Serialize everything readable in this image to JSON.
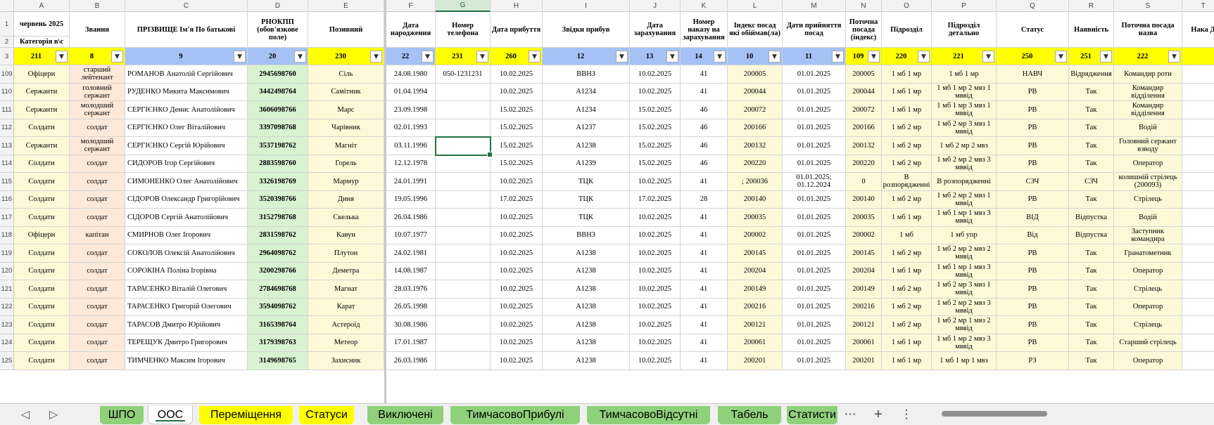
{
  "columns": [
    {
      "letter": "A",
      "width": 79
    },
    {
      "letter": "B",
      "width": 79
    },
    {
      "letter": "C",
      "width": 174
    },
    {
      "letter": "D",
      "width": 86
    },
    {
      "letter": "E",
      "width": 108
    },
    {
      "letter": "F",
      "width": 70
    },
    {
      "letter": "G",
      "width": 78
    },
    {
      "letter": "H",
      "width": 74
    },
    {
      "letter": "I",
      "width": 124
    },
    {
      "letter": "J",
      "width": 72
    },
    {
      "letter": "K",
      "width": 67
    },
    {
      "letter": "L",
      "width": 78
    },
    {
      "letter": "M",
      "width": 90
    },
    {
      "letter": "N",
      "width": 51
    },
    {
      "letter": "O",
      "width": 71
    },
    {
      "letter": "P",
      "width": 92
    },
    {
      "letter": "Q",
      "width": 103
    },
    {
      "letter": "R",
      "width": 64
    },
    {
      "letter": "S",
      "width": 97
    },
    {
      "letter": "T",
      "width": 60
    }
  ],
  "header_row1_2": [
    "",
    "Звання",
    "ПРІЗВИЩЕ Ім'я По батькові",
    "РНОКПП (обов'язкове поле)",
    "Позивний",
    "Дата народження",
    "Номер телефона",
    "Дата прибуття",
    "Звідки прибув",
    "Дата зарахування",
    "Номер наказу на зарахування",
    "Індекс посад які обіймав(ла)",
    "Дати прийняття посад",
    "Поточна посада (індекс)",
    "Підрозділ",
    "Підрозділ детально",
    "Статус",
    "Наявність",
    "Поточна посада назва",
    "Нака Д"
  ],
  "header_a_top": "червень 2025",
  "header_a_bottom": "Категорія в\\с",
  "row3_values": [
    "211",
    "8",
    "9",
    "20",
    "230",
    "22",
    "231",
    "260",
    "12",
    "13",
    "14",
    "10",
    "11",
    "109",
    "220",
    "221",
    "250",
    "251",
    "222",
    ""
  ],
  "row3_colors": [
    "#ffff00",
    "#ffff00",
    "#a4c2f4",
    "#a4c2f4",
    "#ffff00",
    "#a4c2f4",
    "#ffff00",
    "#ffff00",
    "#a4c2f4",
    "#a4c2f4",
    "#a4c2f4",
    "#a4c2f4",
    "#a4c2f4",
    "#ffff00",
    "#ffff00",
    "#ffff00",
    "#ffff00",
    "#ffff00",
    "#ffff00",
    "#ffff00"
  ],
  "col_fills": [
    "#fdf8d7",
    "#fde9d9",
    "#ffffff",
    "#d9f2d0",
    "#fdf8d7",
    "#ffffff",
    "#ffffff",
    "#ffffff",
    "#ffffff",
    "#ffffff",
    "#ffffff",
    "#fdf8d7",
    "#ffffff",
    "#fdf8d7",
    "#fdf8d7",
    "#fdf8d7",
    "#fdf8d7",
    "#fdf8d7",
    "#fdf8d7",
    "#ffffff"
  ],
  "rows": [
    {
      "n": "109",
      "cells": [
        "Офіцери",
        "старший лейтенант",
        "РОМАНОВ Анатолій Сергійович",
        "2945698760",
        "Сіль",
        "24.08.1980",
        "050-1231231",
        "10.02.2025",
        "ВВНЗ",
        "10.02.2025",
        "41",
        "200005",
        "01.01.2025",
        "200005",
        "1 мб 1 мр",
        "1 мб 1 мр",
        "НАВЧ",
        "Відрядження",
        "Командир роти",
        ""
      ]
    },
    {
      "n": "110",
      "cells": [
        "Сержанти",
        "головний сержант",
        "РУДЕНКО Микита Максимович",
        "3442498764",
        "Самітник",
        "01.04.1994",
        "",
        "10.02.2025",
        "А1234",
        "10.02.2025",
        "41",
        "200044",
        "01.01.2025",
        "200044",
        "1 мб 1 мр",
        "1 мб 1 мр 2 мвз 1 мввід",
        "РВ",
        "Так",
        "Командир відділення",
        ""
      ]
    },
    {
      "n": "111",
      "cells": [
        "Сержанти",
        "молодший сержант",
        "СЕРГІЄНКО Денис Анатолійович",
        "3606098766",
        "Марс",
        "23.09.1998",
        "",
        "15.02.2025",
        "А1234",
        "15.02.2025",
        "46",
        "200072",
        "01.01.2025",
        "200072",
        "1 мб 1 мр",
        "1 мб 1 мр 3 мвз 1 мввід",
        "РВ",
        "Так",
        "Командир відділення",
        ""
      ]
    },
    {
      "n": "112",
      "cells": [
        "Солдати",
        "солдат",
        "СЕРГІЄНКО Олег Віталійович",
        "3397098768",
        "Чарівник",
        "02.01.1993",
        "",
        "15.02.2025",
        "А1237",
        "15.02.2025",
        "46",
        "200166",
        "01.01.2025",
        "200166",
        "1 мб 2 мр",
        "1 мб 2 мр 3 мвз 1 мввід",
        "РВ",
        "Так",
        "Водій",
        ""
      ]
    },
    {
      "n": "113",
      "cells": [
        "Сержанти",
        "молодший сержант",
        "СЕРГІЄНКО Сергій Юрійович",
        "3537198762",
        "Магніт",
        "03.11.1996",
        "",
        "15.02.2025",
        "А1238",
        "15.02.2025",
        "46",
        "200132",
        "01.01.2025",
        "200132",
        "1 мб 2 мр",
        "1 мб 2 мр 2 мвз",
        "РВ",
        "Так",
        "Головний сержант взводу",
        ""
      ]
    },
    {
      "n": "114",
      "cells": [
        "Солдати",
        "солдат",
        "СИДОРОВ Ігор Сергійович",
        "2883598760",
        "Горель",
        "12.12.1978",
        "",
        "15.02.2025",
        "А1239",
        "15.02.2025",
        "46",
        "200220",
        "01.01.2025",
        "200220",
        "1 мб 2 мр",
        "1 мб 2 мр 2 мвз 3 мввід",
        "РВ",
        "Так",
        "Оператор",
        ""
      ]
    },
    {
      "n": "115",
      "cells": [
        "Солдати",
        "солдат",
        "СИМОНЕНКО Олег Анатолійович",
        "3326198769",
        "Мармур",
        "24.01.1991",
        "",
        "10.02.2025",
        "ТЦК",
        "10.02.2025",
        "41",
        "; 200036",
        "01.01.2025; 01.12.2024",
        "0",
        "В розпорядженні",
        "В розпорядженні",
        "СЗЧ",
        "СЗЧ",
        "колишній стрілець (200093)",
        ""
      ]
    },
    {
      "n": "116",
      "cells": [
        "Солдати",
        "солдат",
        "СІДОРОВ Олександр Григорійович",
        "3520398766",
        "Диня",
        "19.05.1996",
        "",
        "17.02.2025",
        "ТЦК",
        "17.02.2025",
        "28",
        "200140",
        "01.01.2025",
        "200140",
        "1 мб 2 мр",
        "1 мб 2 мр 2 мвз 1 мввід",
        "РВ",
        "Так",
        "Стрілець",
        ""
      ]
    },
    {
      "n": "117",
      "cells": [
        "Солдати",
        "солдат",
        "СІДОРОВ Сергій Анатолійович",
        "3152798768",
        "Скелька",
        "26.04.1986",
        "",
        "10.02.2025",
        "ТЦК",
        "10.02.2025",
        "41",
        "200035",
        "01.01.2025",
        "200035",
        "1 мб 1 мр",
        "1 мб 1 мр 1 мвз 3 мввід",
        "ВІД",
        "Відпустка",
        "Водій",
        ""
      ]
    },
    {
      "n": "118",
      "cells": [
        "Офіцери",
        "капітан",
        "СМИРНОВ Олег Ігорович",
        "2831598762",
        "Кавун",
        "10.07.1977",
        "",
        "10.02.2025",
        "ВВНЗ",
        "10.02.2025",
        "41",
        "200002",
        "01.01.2025",
        "200002",
        "1 мб",
        "1 мб упр",
        "Від",
        "Відпустка",
        "Заступник командира",
        ""
      ]
    },
    {
      "n": "119",
      "cells": [
        "Солдати",
        "солдат",
        "СОКОЛОВ Олексій Анатолійович",
        "2964098762",
        "Плутон",
        "24.02.1981",
        "",
        "10.02.2025",
        "А1238",
        "10.02.2025",
        "41",
        "200145",
        "01.01.2025",
        "200145",
        "1 мб 2 мр",
        "1 мб 2 мр 2 мвз 2 мввід",
        "РВ",
        "Так",
        "Гранатометник",
        ""
      ]
    },
    {
      "n": "120",
      "cells": [
        "Солдати",
        "солдат",
        "СОРОКІНА Поліна Ігорівна",
        "3200298766",
        "Деметра",
        "14.08.1987",
        "",
        "10.02.2025",
        "А1238",
        "10.02.2025",
        "41",
        "200204",
        "01.01.2025",
        "200204",
        "1 мб 1 мр",
        "1 мб 1 мр 1 мвз 3 мввід",
        "РВ",
        "Так",
        "Оператор",
        ""
      ]
    },
    {
      "n": "121",
      "cells": [
        "Солдати",
        "солдат",
        "ТАРАСЕНКО Віталій Олегович",
        "2784698768",
        "Магнат",
        "28.03.1976",
        "",
        "10.02.2025",
        "А1238",
        "10.02.2025",
        "41",
        "200149",
        "01.01.2025",
        "200149",
        "1 мб 2 мр",
        "1 мб 2 мр 3 мвз 1 мввід",
        "РВ",
        "Так",
        "Стрілець",
        ""
      ]
    },
    {
      "n": "122",
      "cells": [
        "Солдати",
        "солдат",
        "ТАРАСЕНКО Григорій Олегович",
        "3594098762",
        "Карат",
        "26.05.1998",
        "",
        "10.02.2025",
        "А1238",
        "10.02.2025",
        "41",
        "200216",
        "01.01.2025",
        "200216",
        "1 мб 2 мр",
        "1 мб 2 мр 2 мвз 3 мввід",
        "РВ",
        "Так",
        "Оператор",
        ""
      ]
    },
    {
      "n": "123",
      "cells": [
        "Солдати",
        "солдат",
        "ТАРАСОВ Дмитро Юрійович",
        "3165398764",
        "Астероїд",
        "30.08.1986",
        "",
        "10.02.2025",
        "А1238",
        "10.02.2025",
        "41",
        "200121",
        "01.01.2025",
        "200121",
        "1 мб 2 мр",
        "1 мб 2 мр 1 мвз 2 мввід",
        "РВ",
        "Так",
        "Стрілець",
        ""
      ]
    },
    {
      "n": "124",
      "cells": [
        "Солдати",
        "солдат",
        "ТЕРЕЩУК Дмитро Григорович",
        "3179398763",
        "Метеор",
        "17.01.1987",
        "",
        "10.02.2025",
        "А1238",
        "10.02.2025",
        "41",
        "200061",
        "01.01.2025",
        "200061",
        "1 мб 1 мр",
        "1 мб 1 мр 2 мвз 3 мввід",
        "РВ",
        "Так",
        "Старший стрілець",
        ""
      ]
    },
    {
      "n": "125",
      "cells": [
        "Солдати",
        "солдат",
        "ТИМЧЕНКО Максим Ігорович",
        "3149698765",
        "Захисник",
        "26.03.1986",
        "",
        "10.02.2025",
        "А1238",
        "10.02.2025",
        "41",
        "200201",
        "01.01.2025",
        "200201",
        "1 мб 1 мр",
        "1 мб 1 мр 1 мвз",
        "РЗ",
        "Так",
        "Оператор",
        ""
      ]
    }
  ],
  "tabs": [
    {
      "label": "ШПО",
      "color": "#8fd07a",
      "active": false
    },
    {
      "label": "ООС",
      "color": "#ffffff",
      "active": true
    },
    {
      "label": "Переміщення",
      "color": "#ffff00",
      "active": false
    },
    {
      "label": "Статуси",
      "color": "#ffff00",
      "active": false
    },
    {
      "label": "Виключені",
      "color": "#8fd07a",
      "active": false
    },
    {
      "label": "ТимчасовоПрибулі",
      "color": "#8fd07a",
      "active": false
    },
    {
      "label": "ТимчасовоВідсутні",
      "color": "#8fd07a",
      "active": false
    },
    {
      "label": "Табель",
      "color": "#8fd07a",
      "active": false
    },
    {
      "label": "Статисти",
      "color": "#8fd07a",
      "active": false
    }
  ],
  "nav_icons": {
    "prev": "◁",
    "next": "▷",
    "more": "⋯",
    "add": "+",
    "options": "⋮"
  },
  "filter_glyph": "▼"
}
